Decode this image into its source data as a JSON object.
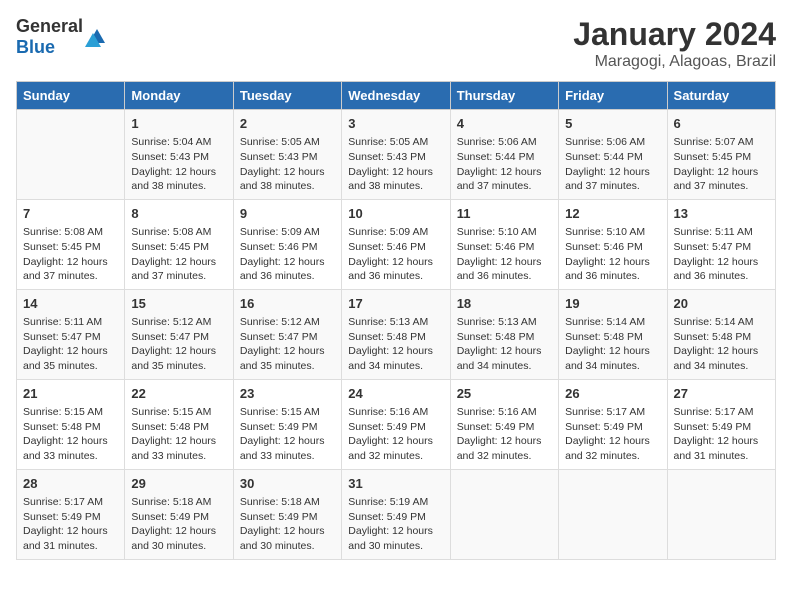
{
  "logo": {
    "text_general": "General",
    "text_blue": "Blue"
  },
  "title": "January 2024",
  "subtitle": "Maragogi, Alagoas, Brazil",
  "days_header": [
    "Sunday",
    "Monday",
    "Tuesday",
    "Wednesday",
    "Thursday",
    "Friday",
    "Saturday"
  ],
  "weeks": [
    [
      {
        "num": "",
        "text": ""
      },
      {
        "num": "1",
        "text": "Sunrise: 5:04 AM\nSunset: 5:43 PM\nDaylight: 12 hours\nand 38 minutes."
      },
      {
        "num": "2",
        "text": "Sunrise: 5:05 AM\nSunset: 5:43 PM\nDaylight: 12 hours\nand 38 minutes."
      },
      {
        "num": "3",
        "text": "Sunrise: 5:05 AM\nSunset: 5:43 PM\nDaylight: 12 hours\nand 38 minutes."
      },
      {
        "num": "4",
        "text": "Sunrise: 5:06 AM\nSunset: 5:44 PM\nDaylight: 12 hours\nand 37 minutes."
      },
      {
        "num": "5",
        "text": "Sunrise: 5:06 AM\nSunset: 5:44 PM\nDaylight: 12 hours\nand 37 minutes."
      },
      {
        "num": "6",
        "text": "Sunrise: 5:07 AM\nSunset: 5:45 PM\nDaylight: 12 hours\nand 37 minutes."
      }
    ],
    [
      {
        "num": "7",
        "text": "Sunrise: 5:08 AM\nSunset: 5:45 PM\nDaylight: 12 hours\nand 37 minutes."
      },
      {
        "num": "8",
        "text": "Sunrise: 5:08 AM\nSunset: 5:45 PM\nDaylight: 12 hours\nand 37 minutes."
      },
      {
        "num": "9",
        "text": "Sunrise: 5:09 AM\nSunset: 5:46 PM\nDaylight: 12 hours\nand 36 minutes."
      },
      {
        "num": "10",
        "text": "Sunrise: 5:09 AM\nSunset: 5:46 PM\nDaylight: 12 hours\nand 36 minutes."
      },
      {
        "num": "11",
        "text": "Sunrise: 5:10 AM\nSunset: 5:46 PM\nDaylight: 12 hours\nand 36 minutes."
      },
      {
        "num": "12",
        "text": "Sunrise: 5:10 AM\nSunset: 5:46 PM\nDaylight: 12 hours\nand 36 minutes."
      },
      {
        "num": "13",
        "text": "Sunrise: 5:11 AM\nSunset: 5:47 PM\nDaylight: 12 hours\nand 36 minutes."
      }
    ],
    [
      {
        "num": "14",
        "text": "Sunrise: 5:11 AM\nSunset: 5:47 PM\nDaylight: 12 hours\nand 35 minutes."
      },
      {
        "num": "15",
        "text": "Sunrise: 5:12 AM\nSunset: 5:47 PM\nDaylight: 12 hours\nand 35 minutes."
      },
      {
        "num": "16",
        "text": "Sunrise: 5:12 AM\nSunset: 5:47 PM\nDaylight: 12 hours\nand 35 minutes."
      },
      {
        "num": "17",
        "text": "Sunrise: 5:13 AM\nSunset: 5:48 PM\nDaylight: 12 hours\nand 34 minutes."
      },
      {
        "num": "18",
        "text": "Sunrise: 5:13 AM\nSunset: 5:48 PM\nDaylight: 12 hours\nand 34 minutes."
      },
      {
        "num": "19",
        "text": "Sunrise: 5:14 AM\nSunset: 5:48 PM\nDaylight: 12 hours\nand 34 minutes."
      },
      {
        "num": "20",
        "text": "Sunrise: 5:14 AM\nSunset: 5:48 PM\nDaylight: 12 hours\nand 34 minutes."
      }
    ],
    [
      {
        "num": "21",
        "text": "Sunrise: 5:15 AM\nSunset: 5:48 PM\nDaylight: 12 hours\nand 33 minutes."
      },
      {
        "num": "22",
        "text": "Sunrise: 5:15 AM\nSunset: 5:48 PM\nDaylight: 12 hours\nand 33 minutes."
      },
      {
        "num": "23",
        "text": "Sunrise: 5:15 AM\nSunset: 5:49 PM\nDaylight: 12 hours\nand 33 minutes."
      },
      {
        "num": "24",
        "text": "Sunrise: 5:16 AM\nSunset: 5:49 PM\nDaylight: 12 hours\nand 32 minutes."
      },
      {
        "num": "25",
        "text": "Sunrise: 5:16 AM\nSunset: 5:49 PM\nDaylight: 12 hours\nand 32 minutes."
      },
      {
        "num": "26",
        "text": "Sunrise: 5:17 AM\nSunset: 5:49 PM\nDaylight: 12 hours\nand 32 minutes."
      },
      {
        "num": "27",
        "text": "Sunrise: 5:17 AM\nSunset: 5:49 PM\nDaylight: 12 hours\nand 31 minutes."
      }
    ],
    [
      {
        "num": "28",
        "text": "Sunrise: 5:17 AM\nSunset: 5:49 PM\nDaylight: 12 hours\nand 31 minutes."
      },
      {
        "num": "29",
        "text": "Sunrise: 5:18 AM\nSunset: 5:49 PM\nDaylight: 12 hours\nand 30 minutes."
      },
      {
        "num": "30",
        "text": "Sunrise: 5:18 AM\nSunset: 5:49 PM\nDaylight: 12 hours\nand 30 minutes."
      },
      {
        "num": "31",
        "text": "Sunrise: 5:19 AM\nSunset: 5:49 PM\nDaylight: 12 hours\nand 30 minutes."
      },
      {
        "num": "",
        "text": ""
      },
      {
        "num": "",
        "text": ""
      },
      {
        "num": "",
        "text": ""
      }
    ]
  ]
}
